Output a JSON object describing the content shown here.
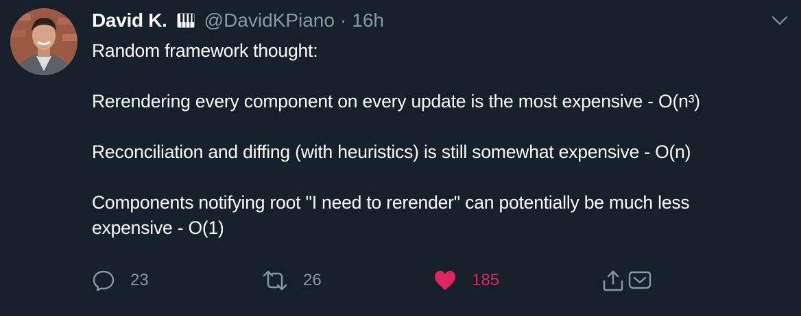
{
  "tweet": {
    "author_name": "David K.",
    "author_emoji_icon": "piano-keys-icon",
    "handle": "@DavidKPiano",
    "separator": "·",
    "time": "16h",
    "text": {
      "line1": "Random framework thought:",
      "line2": "Rerendering every component on every update is the most expensive - O(n³)",
      "line3": "Reconciliation and diffing (with heuristics) is still somewhat expensive - O(n)",
      "line4a": "Components notifying root \"I need to rerender\" can potentially be much less",
      "line4b": "expensive - O(1)"
    },
    "actions": {
      "reply_count": "23",
      "retweet_count": "26",
      "like_count": "185"
    },
    "colors": {
      "background": "#15202b",
      "muted": "#8899a6",
      "like": "#e0245e",
      "text": "#ffffff"
    }
  }
}
